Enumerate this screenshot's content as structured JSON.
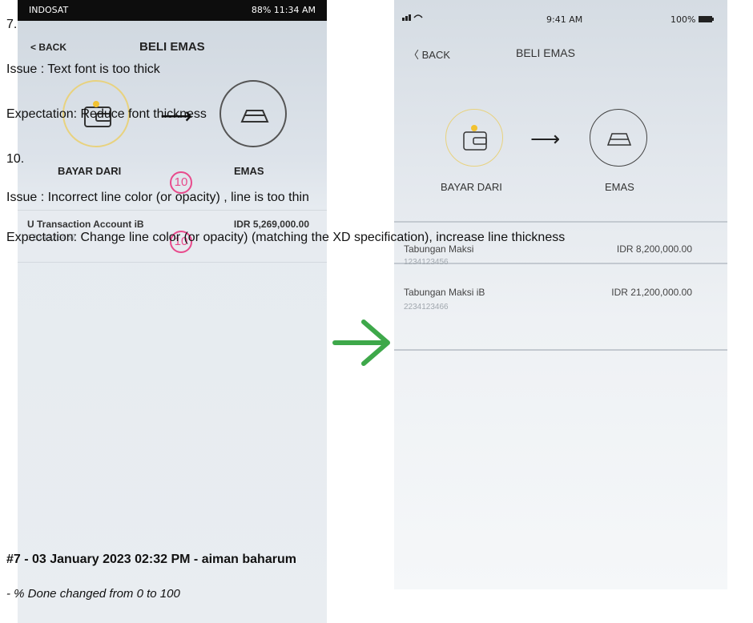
{
  "left_phone": {
    "status": {
      "carrier": "INDOSAT",
      "right": "88%  11:34 AM"
    },
    "nav": {
      "back": "< BACK",
      "title": "BELI EMAS"
    },
    "labels": {
      "from": "BAYAR DARI",
      "to": "EMAS"
    },
    "markers": [
      "10",
      "10"
    ],
    "account": {
      "name": "U Transaction Account iB",
      "amount": "IDR 5,269,000.00",
      "number": "1234123457"
    }
  },
  "right_phone": {
    "status": {
      "time": "9:41 AM",
      "battery": "100%"
    },
    "nav": {
      "back": "BACK",
      "title": "BELI EMAS"
    },
    "labels": {
      "from": "BAYAR DARI",
      "to": "EMAS"
    },
    "accounts": [
      {
        "name": "Tabungan Maksi",
        "amount": "IDR 8,200,000.00",
        "number": "1234123456"
      },
      {
        "name": "Tabungan Maksi iB",
        "amount": "IDR 21,200,000.00",
        "number": "2234123466"
      }
    ]
  },
  "notes": {
    "item7": "7.",
    "issue1": "Issue : Text font is too thick",
    "expectation1": "Expectation: Reduce font thickness",
    "item10": "10.",
    "issue2": "Issue : Incorrect line color (or opacity) , line is too thin",
    "expectation2": "Expectation: Change line color (or opacity) (matching the XD specification), increase line thickness"
  },
  "journal": {
    "header": "#7 - 03 January 2023 02:32 PM - aiman baharum",
    "detail": "- % Done changed from 0 to 100"
  },
  "colors": {
    "accent_gold": "#e8d27e",
    "marker_pink": "#e84a8c",
    "arrow_green": "#3ea84a"
  }
}
